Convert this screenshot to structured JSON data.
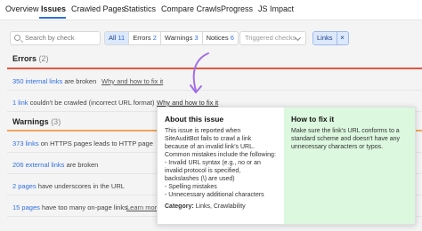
{
  "nav": {
    "tabs": [
      {
        "label": "Overview"
      },
      {
        "label": "Issues"
      },
      {
        "label": "Crawled Pages"
      },
      {
        "label": "Statistics"
      },
      {
        "label": "Compare Crawls"
      },
      {
        "label": "Progress"
      },
      {
        "label": "JS Impact"
      }
    ],
    "active_index": 1
  },
  "filters": {
    "search_placeholder": "Search by check",
    "segments": [
      {
        "label": "All",
        "count": "11",
        "selected": true
      },
      {
        "label": "Errors",
        "count": "2",
        "selected": false
      },
      {
        "label": "Warnings",
        "count": "3",
        "selected": false
      },
      {
        "label": "Notices",
        "count": "6",
        "selected": false
      }
    ],
    "triggered_checks": "Triggered checks",
    "chip_label": "Links",
    "chip_close": "×"
  },
  "errors": {
    "title": "Errors",
    "count": "(2)",
    "items": [
      {
        "link": "350 internal links",
        "text": " are broken",
        "why": "Why and how to fix it"
      },
      {
        "link": "1 link",
        "text": " couldn't be crawled (incorrect URL format)",
        "why": "Why and how to fix it"
      }
    ]
  },
  "warnings": {
    "title": "Warnings",
    "count": "(3)",
    "items": [
      {
        "link": "373 links",
        "text": " on HTTPS pages leads to HTTP page"
      },
      {
        "link": "206 external links",
        "text": " are broken"
      },
      {
        "link": "2 pages",
        "text": " have underscores in the URL"
      },
      {
        "link": "15 pages",
        "text": " have too many on-page links",
        "more": "Learn more"
      }
    ]
  },
  "popup": {
    "about_title": "About this issue",
    "about_body": "This issue is reported when\nSiteAuditBot fails to crawl a link\nbecause of an invalid link's URL.\nCommon mistakes include the following:\n- Invalid URL syntax (e.g., no or an\ninvalid protocol is specified,\nbackslashes (\\) are used)\n- Spelling mistakes\n- Unnecessary additional characters",
    "category_label": "Category:",
    "category_value": " Links, Crawlability",
    "fix_title": "How to fix it",
    "fix_body": "Make sure the link's URL conforms to a\nstandard scheme and doesn't have any\nunnecessary characters or typos."
  },
  "colors": {
    "accent": "#2f6fdf",
    "errors_bar": "#e8543f",
    "warnings_bar": "#f0a45a",
    "fix_bg": "#dcf8df",
    "annotation_arrow": "#a36ee6"
  }
}
